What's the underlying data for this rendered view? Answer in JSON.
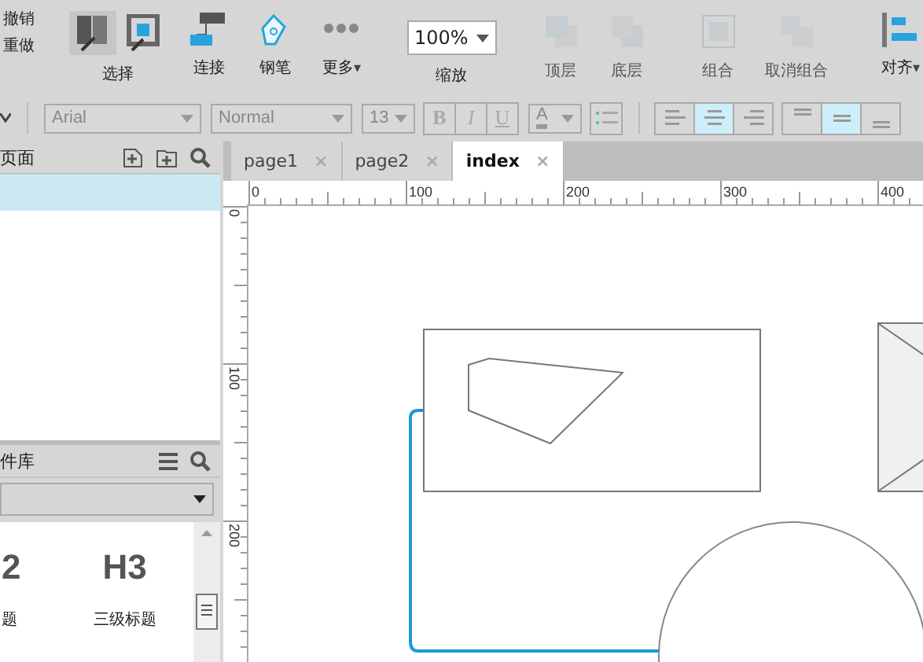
{
  "toolbar": {
    "history": [
      "撤销",
      "重做"
    ],
    "select": {
      "label": "选择",
      "modes": [
        {
          "selected": true
        },
        {
          "selected": false
        }
      ]
    },
    "tools": [
      {
        "label": "连接",
        "kind": "connector"
      },
      {
        "label": "钢笔",
        "kind": "pen"
      },
      {
        "label": "更多",
        "kind": "more",
        "caret": "▾"
      }
    ],
    "zoom": {
      "value": "100%",
      "label": "缩放"
    },
    "arrange": [
      {
        "label": "顶层",
        "kind": "front",
        "disabled": true
      },
      {
        "label": "底层",
        "kind": "back",
        "disabled": true
      },
      {
        "label": "组合",
        "kind": "group",
        "disabled": true
      },
      {
        "label": "取消组合",
        "kind": "ungroup",
        "disabled": true
      }
    ],
    "align": {
      "label": "对齐",
      "caret": "▾"
    }
  },
  "format_bar": {
    "font": "Arial",
    "style": "Normal",
    "size": "13",
    "text_styles": [
      {
        "label": "B",
        "disabled": true
      },
      {
        "label": "I",
        "disabled": true
      },
      {
        "label": "U",
        "disabled": true
      }
    ],
    "font_color": {
      "label": "A"
    },
    "horizontal_align": [
      {
        "selected": false
      },
      {
        "selected": true
      },
      {
        "selected": false
      }
    ],
    "vertical_align": [
      {
        "selected": false
      },
      {
        "selected": true
      },
      {
        "selected": false
      }
    ]
  },
  "pages_panel": {
    "title": "页面",
    "rows": [
      {
        "selected": true
      }
    ]
  },
  "library_panel": {
    "title": "件库",
    "items": [
      {
        "preview": "2",
        "label": "题"
      },
      {
        "preview": "H3",
        "label": "三级标题"
      }
    ]
  },
  "tabs": [
    {
      "label": "page1",
      "selected": false,
      "close": "×"
    },
    {
      "label": "page2",
      "selected": false,
      "close": "×"
    },
    {
      "label": "index",
      "selected": true,
      "close": "×"
    }
  ],
  "rulers": {
    "x_labels": [
      "0",
      "100",
      "200",
      "300",
      "400"
    ],
    "y_labels": [
      "0",
      "100",
      "200"
    ]
  }
}
